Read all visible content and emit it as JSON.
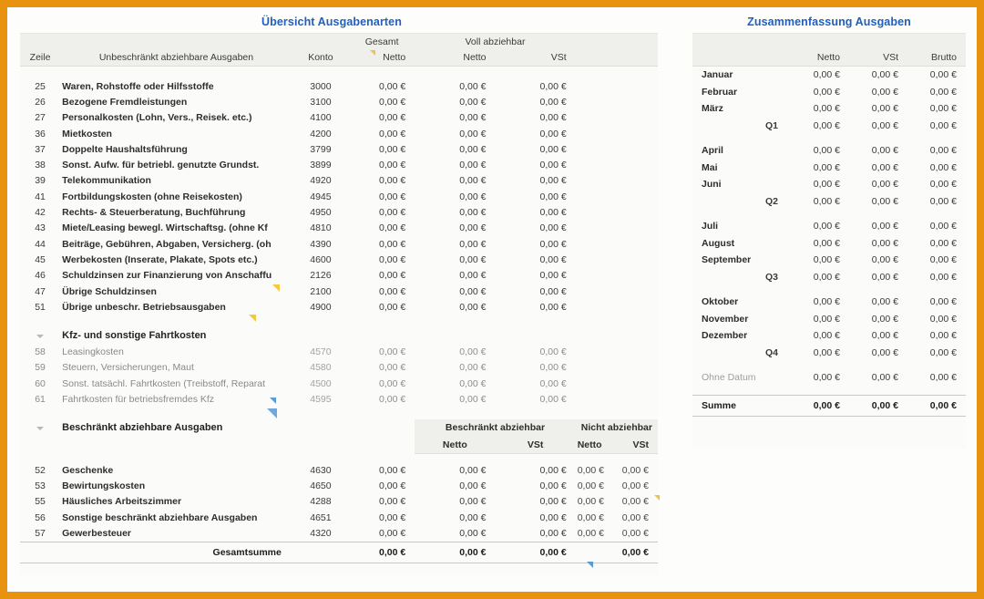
{
  "left_panel": {
    "title": "Übersicht Ausgabenarten",
    "group_headers": {
      "gesamt": "Gesamt",
      "voll_abziehbar": "Voll abziehbar",
      "beschraenkt_abziehbar": "Beschränkt abziehbar",
      "nicht_abziehbar": "Nicht abziehbar"
    },
    "columns": {
      "zeile": "Zeile",
      "description": "Unbeschränkt abziehbare Ausgaben",
      "konto": "Konto",
      "gesamt_netto": "Netto",
      "voll_netto": "Netto",
      "voll_vst": "VSt",
      "besch_netto": "Netto",
      "besch_vst": "VSt",
      "nicht_netto": "Netto",
      "nicht_vst": "VSt"
    },
    "rows_unrestricted": [
      {
        "zeile": "25",
        "desc": "Waren, Rohstoffe oder Hilfsstoffe",
        "konto": "3000",
        "gesamt_netto": "0,00 €",
        "voll_netto": "0,00 €",
        "voll_vst": "0,00 €"
      },
      {
        "zeile": "26",
        "desc": "Bezogene Fremdleistungen",
        "konto": "3100",
        "gesamt_netto": "0,00 €",
        "voll_netto": "0,00 €",
        "voll_vst": "0,00 €"
      },
      {
        "zeile": "27",
        "desc": "Personalkosten (Lohn, Vers., Reisek. etc.)",
        "konto": "4100",
        "gesamt_netto": "0,00 €",
        "voll_netto": "0,00 €",
        "voll_vst": "0,00 €"
      },
      {
        "zeile": "36",
        "desc": "Mietkosten",
        "konto": "4200",
        "gesamt_netto": "0,00 €",
        "voll_netto": "0,00 €",
        "voll_vst": "0,00 €"
      },
      {
        "zeile": "37",
        "desc": "Doppelte Haushaltsführung",
        "konto": "3799",
        "gesamt_netto": "0,00 €",
        "voll_netto": "0,00 €",
        "voll_vst": "0,00 €"
      },
      {
        "zeile": "38",
        "desc": "Sonst. Aufw. für betriebl. genutzte Grundst.",
        "konto": "3899",
        "gesamt_netto": "0,00 €",
        "voll_netto": "0,00 €",
        "voll_vst": "0,00 €"
      },
      {
        "zeile": "39",
        "desc": "Telekommunikation",
        "konto": "4920",
        "gesamt_netto": "0,00 €",
        "voll_netto": "0,00 €",
        "voll_vst": "0,00 €"
      },
      {
        "zeile": "41",
        "desc": "Fortbildungskosten (ohne Reisekosten)",
        "konto": "4945",
        "gesamt_netto": "0,00 €",
        "voll_netto": "0,00 €",
        "voll_vst": "0,00 €"
      },
      {
        "zeile": "42",
        "desc": "Rechts- & Steuerberatung, Buchführung",
        "konto": "4950",
        "gesamt_netto": "0,00 €",
        "voll_netto": "0,00 €",
        "voll_vst": "0,00 €"
      },
      {
        "zeile": "43",
        "desc": "Miete/Leasing bewegl. Wirtschaftsg. (ohne Kf",
        "konto": "4810",
        "gesamt_netto": "0,00 €",
        "voll_netto": "0,00 €",
        "voll_vst": "0,00 €"
      },
      {
        "zeile": "44",
        "desc": "Beiträge, Gebühren, Abgaben, Versicherg. (oh",
        "konto": "4390",
        "gesamt_netto": "0,00 €",
        "voll_netto": "0,00 €",
        "voll_vst": "0,00 €"
      },
      {
        "zeile": "45",
        "desc": "Werbekosten (Inserate, Plakate, Spots etc.)",
        "konto": "4600",
        "gesamt_netto": "0,00 €",
        "voll_netto": "0,00 €",
        "voll_vst": "0,00 €"
      },
      {
        "zeile": "46",
        "desc": "Schuldzinsen zur Finanzierung von Anschaffu",
        "konto": "2126",
        "gesamt_netto": "0,00 €",
        "voll_netto": "0,00 €",
        "voll_vst": "0,00 €"
      },
      {
        "zeile": "47",
        "desc": "Übrige Schuldzinsen",
        "konto": "2100",
        "gesamt_netto": "0,00 €",
        "voll_netto": "0,00 €",
        "voll_vst": "0,00 €"
      },
      {
        "zeile": "51",
        "desc": "Übrige unbeschr. Betriebsausgaben",
        "konto": "4900",
        "gesamt_netto": "0,00 €",
        "voll_netto": "0,00 €",
        "voll_vst": "0,00 €"
      }
    ],
    "group_kfz": {
      "label": "Kfz- und sonstige Fahrtkosten",
      "rows": [
        {
          "zeile": "58",
          "desc": "Leasingkosten",
          "konto": "4570",
          "gesamt_netto": "0,00 €",
          "voll_netto": "0,00 €",
          "voll_vst": "0,00 €"
        },
        {
          "zeile": "59",
          "desc": "Steuern, Versicherungen, Maut",
          "konto": "4580",
          "gesamt_netto": "0,00 €",
          "voll_netto": "0,00 €",
          "voll_vst": "0,00 €"
        },
        {
          "zeile": "60",
          "desc": "Sonst. tatsächl. Fahrtkosten (Treibstoff, Reparat",
          "konto": "4500",
          "gesamt_netto": "0,00 €",
          "voll_netto": "0,00 €",
          "voll_vst": "0,00 €"
        },
        {
          "zeile": "61",
          "desc": "Fahrtkosten für betriebsfremdes Kfz",
          "konto": "4595",
          "gesamt_netto": "0,00 €",
          "voll_netto": "0,00 €",
          "voll_vst": "0,00 €"
        }
      ]
    },
    "group_restricted": {
      "label": "Beschränkt abziehbare Ausgaben",
      "rows": [
        {
          "zeile": "52",
          "desc": "Geschenke",
          "konto": "4630",
          "gesamt_netto": "0,00 €",
          "besch_netto": "0,00 €",
          "besch_vst": "0,00 €",
          "nicht_netto": "0,00 €",
          "nicht_vst": "0,00 €"
        },
        {
          "zeile": "53",
          "desc": "Bewirtungskosten",
          "konto": "4650",
          "gesamt_netto": "0,00 €",
          "besch_netto": "0,00 €",
          "besch_vst": "0,00 €",
          "nicht_netto": "0,00 €",
          "nicht_vst": "0,00 €"
        },
        {
          "zeile": "55",
          "desc": "Häusliches Arbeitszimmer",
          "konto": "4288",
          "gesamt_netto": "0,00 €",
          "besch_netto": "0,00 €",
          "besch_vst": "0,00 €",
          "nicht_netto": "0,00 €",
          "nicht_vst": "0,00 €"
        },
        {
          "zeile": "56",
          "desc": "Sonstige beschränkt abziehbare Ausgaben",
          "konto": "4651",
          "gesamt_netto": "0,00 €",
          "besch_netto": "0,00 €",
          "besch_vst": "0,00 €",
          "nicht_netto": "0,00 €",
          "nicht_vst": "0,00 €"
        },
        {
          "zeile": "57",
          "desc": "Gewerbesteuer",
          "konto": "4320",
          "gesamt_netto": "0,00 €",
          "besch_netto": "0,00 €",
          "besch_vst": "0,00 €",
          "nicht_netto": "0,00 €",
          "nicht_vst": "0,00 €"
        }
      ]
    },
    "total": {
      "label": "Gesamtsumme",
      "gesamt_netto": "0,00 €",
      "besch_netto": "0,00 €",
      "besch_vst": "0,00 €",
      "nicht_netto": "0,00 €"
    }
  },
  "right_panel": {
    "title": "Zusammenfassung Ausgaben",
    "columns": {
      "netto": "Netto",
      "vst": "VSt",
      "brutto": "Brutto"
    },
    "rows": [
      {
        "kind": "month",
        "name": "Januar",
        "netto": "0,00 €",
        "vst": "0,00 €",
        "brutto": "0,00 €"
      },
      {
        "kind": "month",
        "name": "Februar",
        "netto": "0,00 €",
        "vst": "0,00 €",
        "brutto": "0,00 €"
      },
      {
        "kind": "month",
        "name": "März",
        "netto": "0,00 €",
        "vst": "0,00 €",
        "brutto": "0,00 €"
      },
      {
        "kind": "quarter",
        "name": "Q1",
        "netto": "0,00 €",
        "vst": "0,00 €",
        "brutto": "0,00 €"
      },
      {
        "kind": "month",
        "name": "April",
        "netto": "0,00 €",
        "vst": "0,00 €",
        "brutto": "0,00 €"
      },
      {
        "kind": "month",
        "name": "Mai",
        "netto": "0,00 €",
        "vst": "0,00 €",
        "brutto": "0,00 €"
      },
      {
        "kind": "month",
        "name": "Juni",
        "netto": "0,00 €",
        "vst": "0,00 €",
        "brutto": "0,00 €"
      },
      {
        "kind": "quarter",
        "name": "Q2",
        "netto": "0,00 €",
        "vst": "0,00 €",
        "brutto": "0,00 €"
      },
      {
        "kind": "month",
        "name": "Juli",
        "netto": "0,00 €",
        "vst": "0,00 €",
        "brutto": "0,00 €"
      },
      {
        "kind": "month",
        "name": "August",
        "netto": "0,00 €",
        "vst": "0,00 €",
        "brutto": "0,00 €"
      },
      {
        "kind": "month",
        "name": "September",
        "netto": "0,00 €",
        "vst": "0,00 €",
        "brutto": "0,00 €"
      },
      {
        "kind": "quarter",
        "name": "Q3",
        "netto": "0,00 €",
        "vst": "0,00 €",
        "brutto": "0,00 €"
      },
      {
        "kind": "month",
        "name": "Oktober",
        "netto": "0,00 €",
        "vst": "0,00 €",
        "brutto": "0,00 €"
      },
      {
        "kind": "month",
        "name": "November",
        "netto": "0,00 €",
        "vst": "0,00 €",
        "brutto": "0,00 €"
      },
      {
        "kind": "month",
        "name": "Dezember",
        "netto": "0,00 €",
        "vst": "0,00 €",
        "brutto": "0,00 €"
      },
      {
        "kind": "quarter",
        "name": "Q4",
        "netto": "0,00 €",
        "vst": "0,00 €",
        "brutto": "0,00 €"
      },
      {
        "kind": "nodate",
        "name": "Ohne Datum",
        "netto": "0,00 €",
        "vst": "0,00 €",
        "brutto": "0,00 €"
      }
    ],
    "total": {
      "label": "Summe",
      "netto": "0,00 €",
      "vst": "0,00 €",
      "brutto": "0,00 €"
    }
  },
  "theme": {
    "border_color": "#e8920f",
    "title_color": "#1f5fbf",
    "sheet_bg": "#fbfbf9",
    "header_band": "#efefec",
    "marker_yellow": "#f2c14a",
    "marker_blue": "#5b9bd5"
  }
}
